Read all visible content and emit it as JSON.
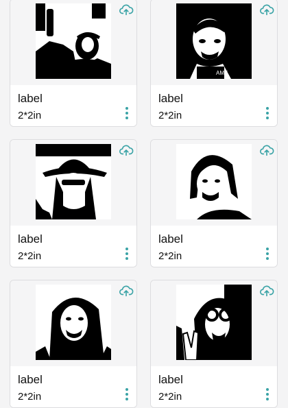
{
  "colors": {
    "accent": "#3aa3a6",
    "card_bg": "#ffffff",
    "image_bg": "#f5f5f6",
    "page_bg": "#f4f4f5"
  },
  "icons": {
    "upload": "cloud-upload-icon",
    "more": "more-vertical-icon"
  },
  "cards": [
    {
      "label": "label",
      "size": "2*2in"
    },
    {
      "label": "label",
      "size": "2*2in"
    },
    {
      "label": "label",
      "size": "2*2in"
    },
    {
      "label": "label",
      "size": "2*2in"
    },
    {
      "label": "label",
      "size": "2*2in"
    },
    {
      "label": "label",
      "size": "2*2in"
    }
  ]
}
